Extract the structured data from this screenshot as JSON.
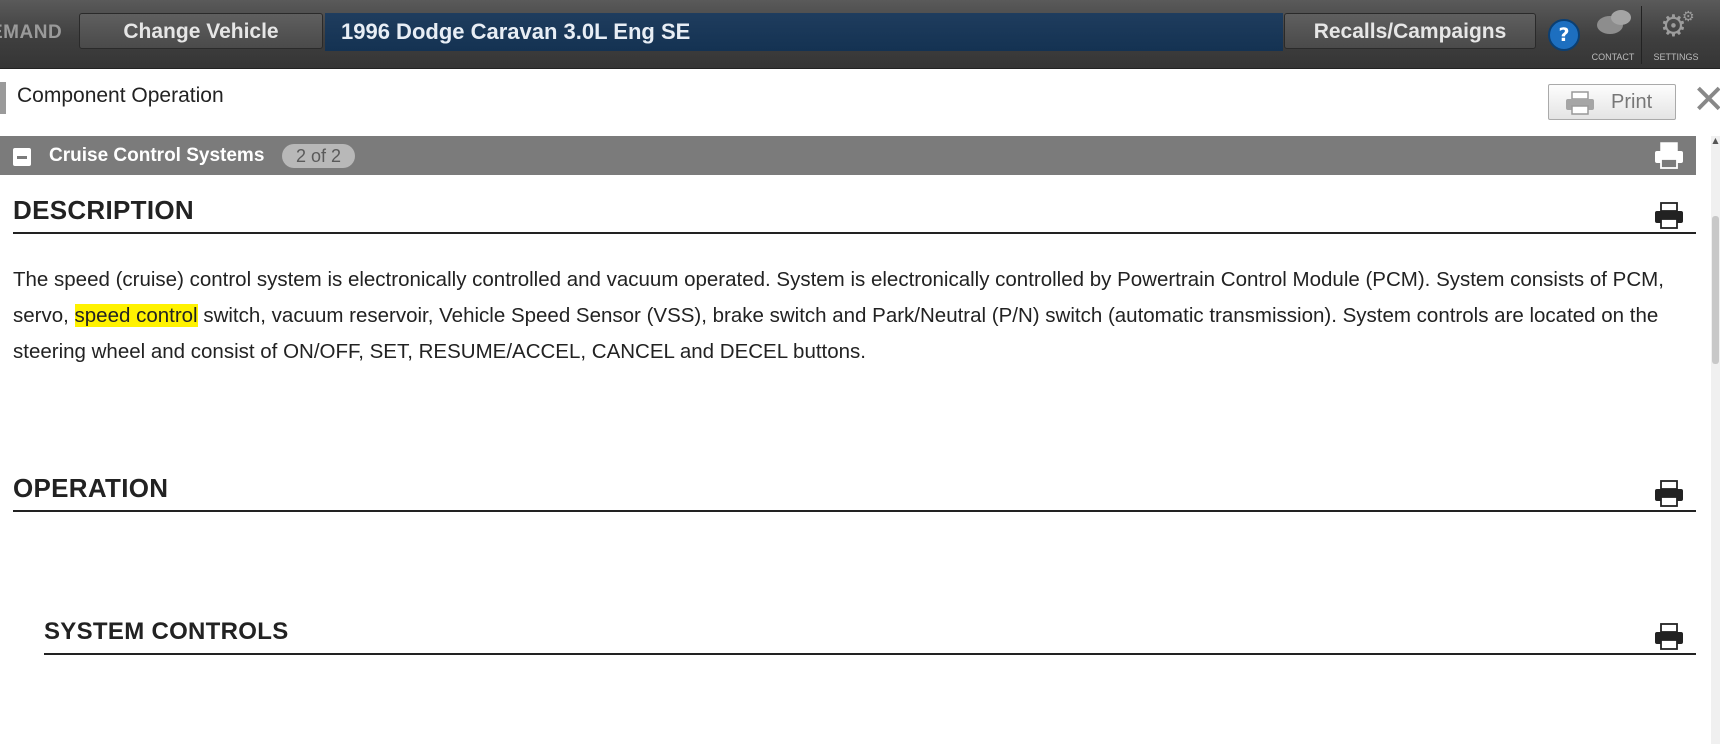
{
  "topbar": {
    "brand": "EMAND",
    "change_vehicle": "Change Vehicle",
    "vehicle": "1996 Dodge Caravan 3.0L Eng SE",
    "recalls": "Recalls/Campaigns",
    "help": "?",
    "contact_label": "CONTACT",
    "settings_label": "SETTINGS"
  },
  "page": {
    "title": "Component Operation",
    "print_label": "Print",
    "close": "✕"
  },
  "section": {
    "title": "Cruise Control Systems",
    "count": "2 of 2"
  },
  "content": {
    "description_heading": "DESCRIPTION",
    "description_before": "The speed (cruise) control system is electronically controlled and vacuum operated. System is electronically controlled by Powertrain Control Module (PCM). System consists of PCM, servo, ",
    "description_highlight": "speed control",
    "description_after": " switch, vacuum reservoir, Vehicle Speed Sensor (VSS), brake switch and Park/Neutral (P/N) switch (automatic transmission). System controls are located on the steering wheel and consist of ON/OFF, SET, RESUME/ACCEL, CANCEL and DECEL buttons.",
    "operation_heading": "OPERATION",
    "system_controls_heading": "SYSTEM CONTROLS"
  },
  "colors": {
    "highlight": "#fff200",
    "vehicle_bar": "#143252",
    "section_bar": "#7b7b7b"
  }
}
